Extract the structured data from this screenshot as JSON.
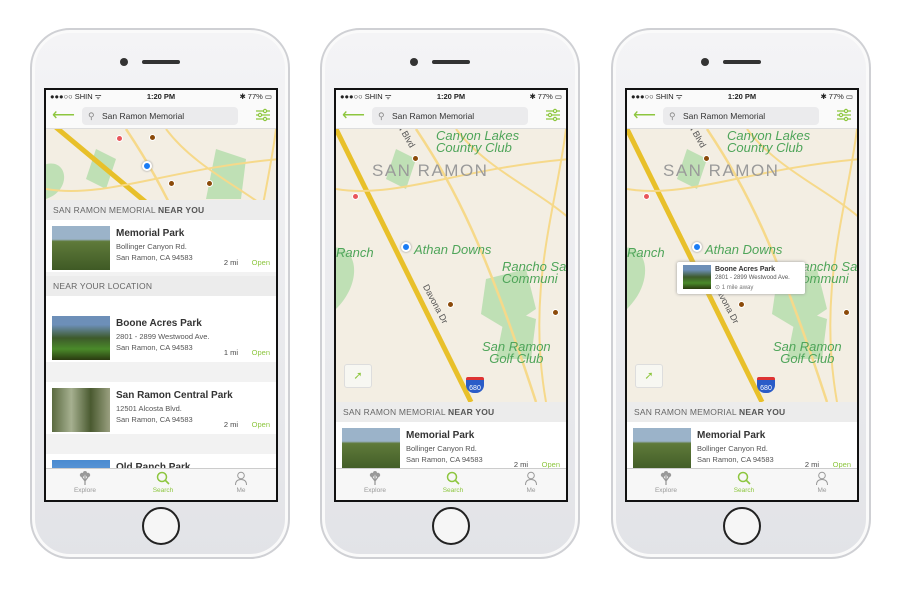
{
  "status": {
    "carrier": "●●●○○ SHIN ᯤ",
    "time": "1:20 PM",
    "battery": "✱ 77% ▭"
  },
  "search": {
    "query": "San Ramon Memorial"
  },
  "section": {
    "near_you_prefix": "SAN RAMON MEMORIAL ",
    "near_you_bold": "NEAR YOU",
    "near_location": "NEAR YOUR LOCATION"
  },
  "tabs": [
    {
      "label": "Explore",
      "icon": "tree-icon"
    },
    {
      "label": "Search",
      "icon": "search-icon"
    },
    {
      "label": "Me",
      "icon": "person-icon"
    }
  ],
  "active_tab": "Search",
  "accent": "#8dc63f",
  "parks": [
    {
      "name": "Memorial Park",
      "addr1": "Bollinger Canyon Rd.",
      "addr2": "San Ramon, CA 94583",
      "dist": "2 mi",
      "status": "Open"
    },
    {
      "name": "Boone Acres Park",
      "addr1": "2801 -  2899 Westwood Ave.",
      "addr2": "San Ramon, CA 94583",
      "dist": "1 mi",
      "status": "Open"
    },
    {
      "name": "San Ramon Central Park",
      "addr1": "12501 Alcosta Blvd.",
      "addr2": "San Ramon, CA 94583",
      "dist": "2 mi",
      "status": "Open"
    },
    {
      "name": "Old Ranch Park"
    }
  ],
  "map": {
    "labels": {
      "canyon_lakes": "Canyon Lakes\nCountry Club",
      "san_ramon": "SAN RAMON",
      "athan": "Athan Downs",
      "ranch": "Ranch",
      "rancho": "Rancho San\nCommuni",
      "golf": "San Ramon\nGolf Club",
      "blvd": "a Blvd",
      "davona": "Davona Dr",
      "freeway": "680"
    }
  },
  "popup": {
    "name": "Boone Acres Park",
    "addr": "2801 -  2899 Westwood Ave.",
    "distance": "1 mile away"
  }
}
